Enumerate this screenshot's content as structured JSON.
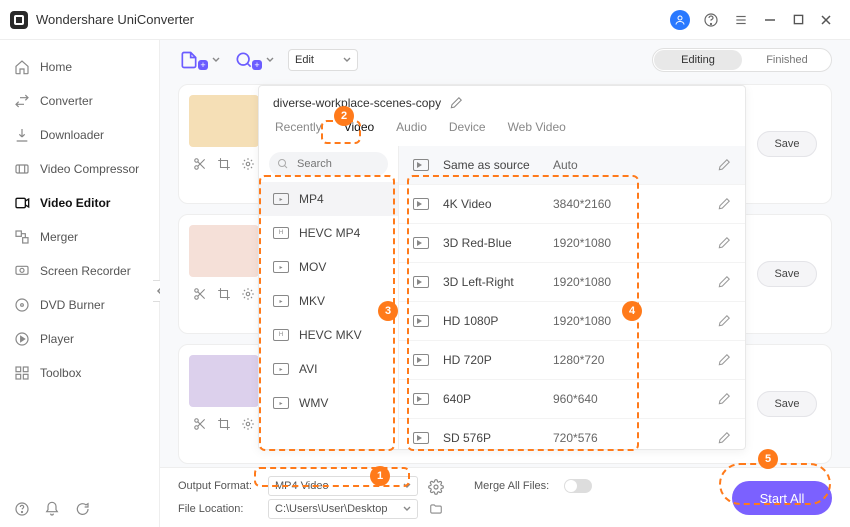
{
  "titlebar": {
    "title": "Wondershare UniConverter"
  },
  "sidebar": {
    "items": [
      {
        "label": "Home"
      },
      {
        "label": "Converter"
      },
      {
        "label": "Downloader"
      },
      {
        "label": "Video Compressor"
      },
      {
        "label": "Video Editor"
      },
      {
        "label": "Merger"
      },
      {
        "label": "Screen Recorder"
      },
      {
        "label": "DVD Burner"
      },
      {
        "label": "Player"
      },
      {
        "label": "Toolbox"
      }
    ]
  },
  "toolbar": {
    "edit_label": "Edit",
    "seg_editing": "Editing",
    "seg_finished": "Finished"
  },
  "cards": {
    "save_label": "Save"
  },
  "panel": {
    "filename": "diverse-workplace-scenes-copy",
    "search_placeholder": "Search",
    "tabs": [
      "Recently",
      "Video",
      "Audio",
      "Device",
      "Web Video"
    ],
    "formats": [
      "MP4",
      "HEVC MP4",
      "MOV",
      "MKV",
      "HEVC MKV",
      "AVI",
      "WMV"
    ],
    "res_header": {
      "name": "Same as source",
      "dim": "Auto"
    },
    "resolutions": [
      {
        "name": "4K Video",
        "dim": "3840*2160"
      },
      {
        "name": "3D Red-Blue",
        "dim": "1920*1080"
      },
      {
        "name": "3D Left-Right",
        "dim": "1920*1080"
      },
      {
        "name": "HD 1080P",
        "dim": "1920*1080"
      },
      {
        "name": "HD 720P",
        "dim": "1280*720"
      },
      {
        "name": "640P",
        "dim": "960*640"
      },
      {
        "name": "SD 576P",
        "dim": "720*576"
      }
    ]
  },
  "bottom": {
    "output_format_label": "Output Format:",
    "output_format_value": "MP4 Video",
    "file_location_label": "File Location:",
    "file_location_value": "C:\\Users\\User\\Desktop",
    "merge_label": "Merge All Files:",
    "start_all": "Start All"
  },
  "annotations": [
    "1",
    "2",
    "3",
    "4",
    "5"
  ]
}
